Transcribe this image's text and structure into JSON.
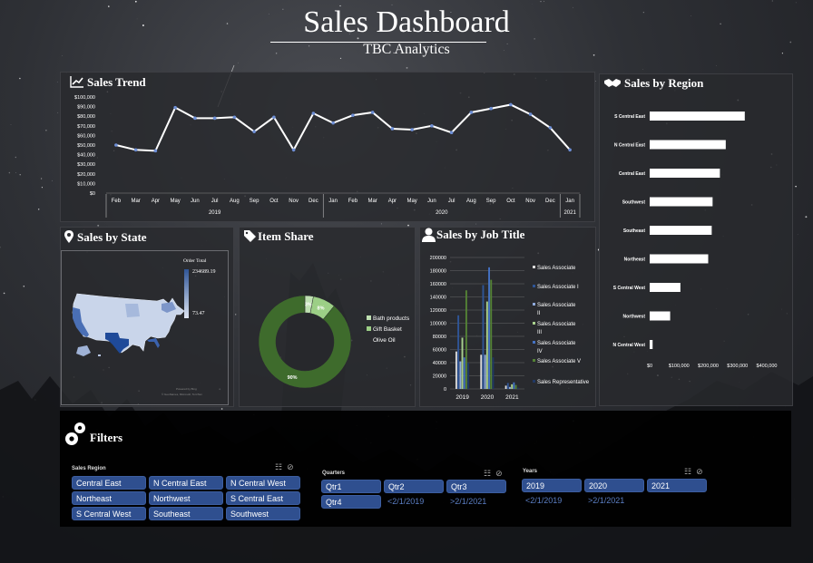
{
  "header": {
    "title": "Sales Dashboard",
    "subtitle": "TBC Analytics"
  },
  "panels": {
    "trend": {
      "title": "Sales Trend",
      "icon": "line-chart-icon"
    },
    "region": {
      "title": "Sales by Region",
      "icon": "handshake-icon"
    },
    "state": {
      "title": "Sales by State",
      "icon": "map-pin-icon"
    },
    "share": {
      "title": "Item Share",
      "icon": "tags-icon"
    },
    "job": {
      "title": "Sales by Job Title",
      "icon": "person-icon"
    }
  },
  "chart_data": [
    {
      "type": "line",
      "x": [
        "Feb",
        "Mar",
        "Apr",
        "May",
        "Jun",
        "Jul",
        "Aug",
        "Sep",
        "Oct",
        "Nov",
        "Dec",
        "Jan",
        "Feb",
        "Mar",
        "Apr",
        "May",
        "Jun",
        "Jul",
        "Aug",
        "Sep",
        "Oct",
        "Nov",
        "Dec",
        "Jan"
      ],
      "year_groups": [
        {
          "label": "2019",
          "count": 11
        },
        {
          "label": "2020",
          "count": 12
        },
        {
          "label": "2021",
          "count": 1
        }
      ],
      "values": [
        50000,
        45000,
        44000,
        89000,
        78000,
        78000,
        79000,
        64000,
        79000,
        45000,
        83000,
        73000,
        81000,
        84000,
        67000,
        66000,
        70000,
        63000,
        84000,
        88000,
        92000,
        82000,
        68000,
        45000
      ],
      "yticks": [
        "$0",
        "$10,000",
        "$20,000",
        "$30,000",
        "$40,000",
        "$50,000",
        "$60,000",
        "$70,000",
        "$80,000",
        "$90,000",
        "$100,000"
      ],
      "ylim": [
        0,
        100000
      ]
    },
    {
      "type": "bar",
      "orientation": "horizontal",
      "categories": [
        "S Central East",
        "N Central East",
        "Central East",
        "Southwest",
        "Southeast",
        "Northeast",
        "S Central West",
        "Northwest",
        "N Central West"
      ],
      "values": [
        325000,
        260000,
        240000,
        215000,
        212000,
        200000,
        105000,
        70000,
        10000
      ],
      "xticks": [
        "$0",
        "$100,000",
        "$200,000",
        "$300,000",
        "$400,000"
      ],
      "xlim": [
        0,
        400000
      ]
    },
    {
      "type": "pie",
      "variant": "donut",
      "slices": [
        {
          "label": "Bath products",
          "value": 3,
          "text": "3%",
          "color": "#bfe0b2"
        },
        {
          "label": "Gift Basket",
          "value": 8,
          "text": "8%",
          "color": "#9ccf86"
        },
        {
          "label": "Olive Oil",
          "value": 90,
          "text": "90%",
          "color": "#3e6b2c"
        }
      ]
    },
    {
      "type": "bar",
      "categories": [
        "2019",
        "2020",
        "2021"
      ],
      "series": [
        {
          "name": "Sales Associate",
          "color": "#d9d9d9",
          "values": [
            57000,
            52000,
            5000
          ]
        },
        {
          "name": "Sales Associate I",
          "color": "#2f5597",
          "values": [
            112000,
            158000,
            9000
          ]
        },
        {
          "name": "Sales Associate II",
          "color": "#8faadc",
          "values": [
            42000,
            52000,
            3000
          ]
        },
        {
          "name": "Sales Associate III",
          "color": "#a9d18e",
          "values": [
            78000,
            133000,
            7000
          ]
        },
        {
          "name": "Sales Associate IV",
          "color": "#4472c4",
          "values": [
            48000,
            185000,
            10000
          ]
        },
        {
          "name": "Sales Associate V",
          "color": "#548235",
          "values": [
            150000,
            166000,
            6000
          ]
        },
        {
          "name": "Sales Representative",
          "color": "#203864",
          "values": [
            40000,
            48000,
            2000
          ]
        }
      ],
      "yticks": [
        "0",
        "20000",
        "40000",
        "60000",
        "80000",
        "100000",
        "120000",
        "140000",
        "160000",
        "180000",
        "200000"
      ],
      "ylim": [
        0,
        200000
      ]
    }
  ],
  "map": {
    "legend_title": "Order Total",
    "legend_max": "234689.19",
    "legend_min": "73.47",
    "credit": "Powered by Bing",
    "credit2": "© GeoNames, Microsoft, TomTom"
  },
  "filters": {
    "heading": "Filters",
    "icon": "gears-icon",
    "region": {
      "title": "Sales Region",
      "items": [
        "Central East",
        "N Central East",
        "N Central West",
        "Northeast",
        "Northwest",
        "S Central East",
        "S Central West",
        "Southeast",
        "Southwest"
      ]
    },
    "quarters": {
      "title": "Quarters",
      "items": [
        "Qtr1",
        "Qtr2",
        "Qtr3",
        "Qtr4"
      ],
      "muted": [
        "<2/1/2019",
        ">2/1/2021"
      ]
    },
    "years": {
      "title": "Years",
      "items": [
        "2019",
        "2020",
        "2021"
      ],
      "muted": [
        "<2/1/2019",
        ">2/1/2021"
      ]
    }
  }
}
